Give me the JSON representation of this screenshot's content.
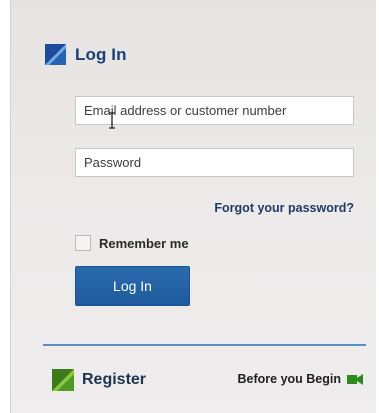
{
  "login": {
    "title": "Log In",
    "email_placeholder": "Email address or customer number",
    "password_placeholder": "Password",
    "forgot_link": "Forgot your password?",
    "remember_label": "Remember me",
    "remember_checked": false,
    "button_label": "Log In"
  },
  "footer": {
    "register_label": "Register",
    "before_label": "Before you Begin"
  },
  "icons": {
    "login_logo": "login-logo-icon",
    "register_logo": "register-logo-icon",
    "video": "video-camera-icon",
    "cursor": "text-cursor-icon"
  },
  "colors": {
    "title": "#1d3f78",
    "button": "#2262a5",
    "divider": "#5b8fc4",
    "video_icon": "#2f8a1e",
    "logo_blue": "#1f4a9a",
    "logo_green": "#3d7a1c"
  }
}
